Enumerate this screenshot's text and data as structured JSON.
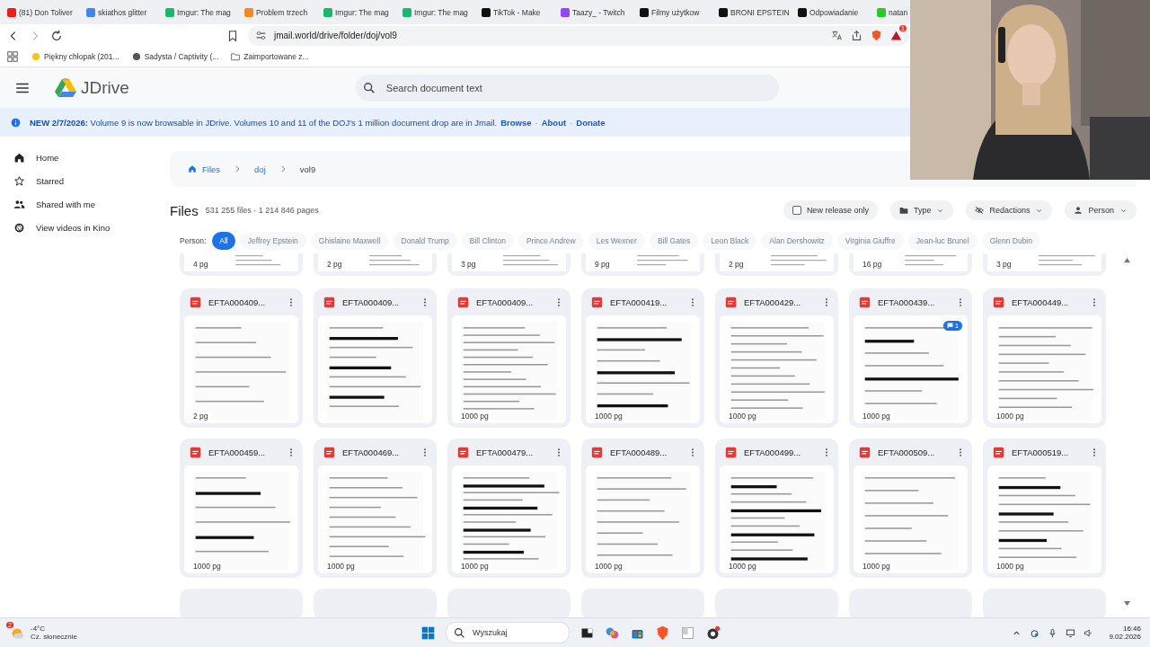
{
  "browser": {
    "tabs": [
      {
        "title": "(81) Don Toliver",
        "color": "#e62117"
      },
      {
        "title": "skiathos glitter",
        "color": "#4285f4"
      },
      {
        "title": "Imgur: The mag",
        "color": "#1bb76e"
      },
      {
        "title": "Problem trzech",
        "color": "#f08a24"
      },
      {
        "title": "Imgur: The mag",
        "color": "#1bb76e"
      },
      {
        "title": "Imgur: The mag",
        "color": "#1bb76e"
      },
      {
        "title": "TikTok - Make",
        "color": "#111111"
      },
      {
        "title": "Taazy_ - Twitch",
        "color": "#9146ff"
      },
      {
        "title": "Filmy użytkow",
        "color": "#111111"
      },
      {
        "title": "BRONI EPSTEIN",
        "color": "#111111"
      },
      {
        "title": "Odpowiadanie",
        "color": "#111111"
      },
      {
        "title": "natan",
        "color": "#28c828"
      }
    ],
    "url": "jmail.world/drive/folder/doj/vol9",
    "bookmarks": [
      "Piękny chłopak (201...",
      "Sadysta / Captivity (...",
      "Zaimportowane z..."
    ],
    "extension_badge": "1"
  },
  "app": {
    "name": "JDrive",
    "search": {
      "placeholder": "Search document text"
    }
  },
  "banner": {
    "text": "**NEW 2/7/2026:** Volume 9 is now browsable in JDrive. Volumes 10 and 11 of the DOJ's 1 million document drop are in Jmail.",
    "links": [
      "Browse",
      "About",
      "Donate"
    ],
    "separator": "·"
  },
  "sidebar": {
    "items": [
      {
        "label": "Home",
        "kind": "home"
      },
      {
        "label": "Starred",
        "kind": "star"
      },
      {
        "label": "Shared with me",
        "kind": "people"
      },
      {
        "label": "View videos in Kino",
        "kind": "camera"
      }
    ]
  },
  "breadcrumb": [
    {
      "label": "Files",
      "kind": "link"
    },
    {
      "label": "doj",
      "kind": "link"
    },
    {
      "label": "vol9",
      "kind": "current"
    }
  ],
  "header": {
    "title": "Files",
    "summary": "531 255 files · 1 214 846 pages"
  },
  "filters": {
    "new_release": {
      "label": "New release only",
      "checked": false
    },
    "dropdowns": [
      {
        "label": "Type",
        "kind": "folder"
      },
      {
        "label": "Redactions",
        "kind": "eye-off"
      },
      {
        "label": "Person",
        "kind": "person"
      }
    ]
  },
  "person_filter": {
    "label": "Person:",
    "chips": [
      {
        "label": "All",
        "selected": true
      },
      {
        "label": "Jeffrey Epstein",
        "selected": false
      },
      {
        "label": "Ghislaine Maxwell",
        "selected": false
      },
      {
        "label": "Donald Trump",
        "selected": false
      },
      {
        "label": "Bill Clinton",
        "selected": false
      },
      {
        "label": "Prince Andrew",
        "selected": false
      },
      {
        "label": "Les Wexner",
        "selected": false
      },
      {
        "label": "Bill Gates",
        "selected": false
      },
      {
        "label": "Leon Black",
        "selected": false
      },
      {
        "label": "Alan Dershowitz",
        "selected": false
      },
      {
        "label": "Virginia Giuffre",
        "selected": false
      },
      {
        "label": "Jean-luc Brunel",
        "selected": false
      },
      {
        "label": "Glenn Dubin",
        "selected": false
      }
    ]
  },
  "partial_row": [
    "4 pg",
    "2 pg",
    "3 pg",
    "9 pg",
    "2 pg",
    "16 pg",
    "3 pg"
  ],
  "files": [
    {
      "name": "EFTA000409...",
      "pages": "2 pg"
    },
    {
      "name": "EFTA000409..."
    },
    {
      "name": "EFTA000409...",
      "pages": "1000 pg"
    },
    {
      "name": "EFTA000419...",
      "pages": "1000 pg"
    },
    {
      "name": "EFTA000429...",
      "pages": "1000 pg"
    },
    {
      "name": "EFTA000439...",
      "pages": "1000 pg",
      "comments": "1"
    },
    {
      "name": "EFTA000449...",
      "pages": "1000 pg"
    },
    {
      "name": "EFTA000459...",
      "pages": "1000 pg"
    },
    {
      "name": "EFTA000469...",
      "pages": "1000 pg"
    },
    {
      "name": "EFTA000479...",
      "pages": "1000 pg"
    },
    {
      "name": "EFTA000489...",
      "pages": "1000 pg"
    },
    {
      "name": "EFTA000499...",
      "pages": "1000 pg"
    },
    {
      "name": "EFTA000509...",
      "pages": "1000 pg"
    },
    {
      "name": "EFTA000519...",
      "pages": "1000 pg"
    }
  ],
  "taskbar": {
    "weather": {
      "badge": "2",
      "temp": "-4°C",
      "condition": "Cz. słonecznie"
    },
    "search": {
      "placeholder": "Wyszukaj"
    },
    "time": "16:46",
    "date": "9.02.2026"
  }
}
